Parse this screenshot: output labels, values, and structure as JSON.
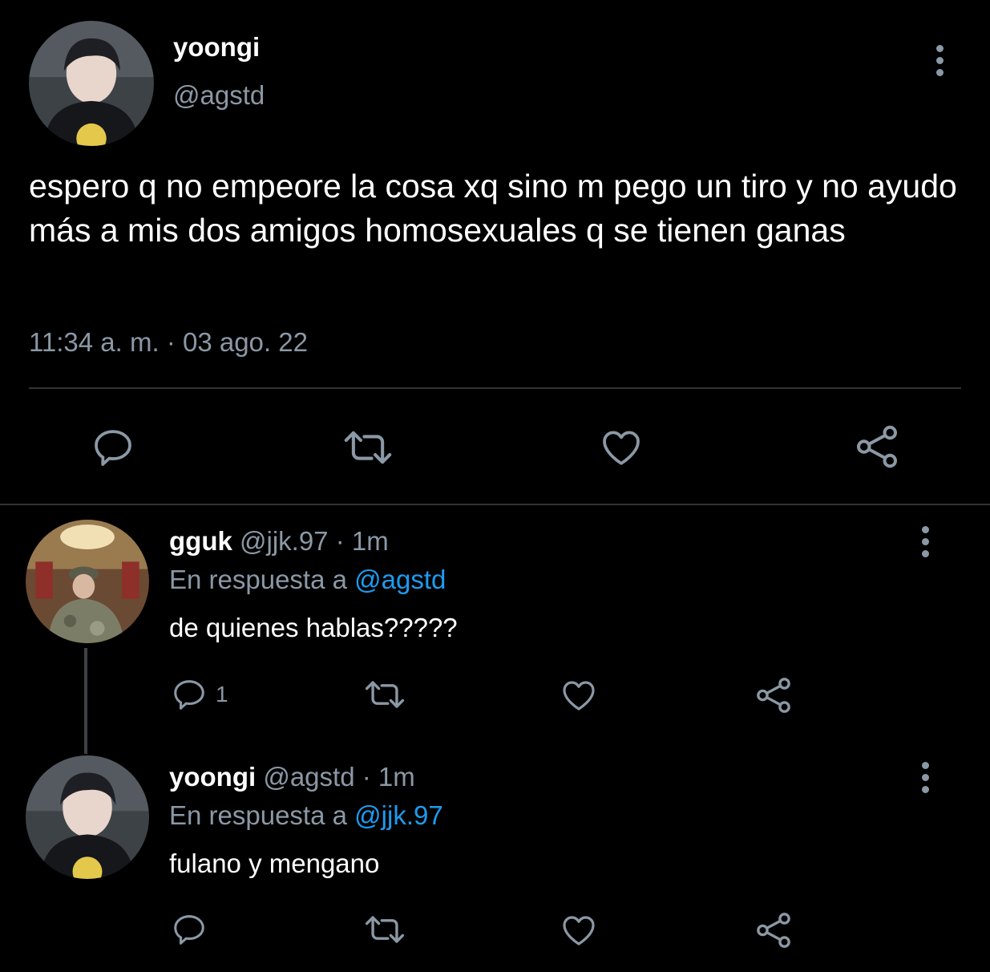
{
  "main_tweet": {
    "name": "yoongi",
    "handle": "@agstd",
    "text": "espero q no empeore la cosa xq sino m pego un tiro y no ayudo más a mis dos amigos homosexuales q se tienen ganas",
    "timestamp": "11:34 a. m. · 03 ago. 22",
    "actions": [
      "reply-icon",
      "retweet-icon",
      "like-icon",
      "share-icon"
    ]
  },
  "replies": [
    {
      "name": "gguk",
      "handle": "@jjk.97",
      "time": "· 1m",
      "reply_prefix": "En respuesta a",
      "reply_to": "@agstd",
      "text": "de quienes hablas?????",
      "reply_count": "1"
    },
    {
      "name": "yoongi",
      "handle": "@agstd",
      "time": "· 1m",
      "reply_prefix": "En respuesta a",
      "reply_to": "@jjk.97",
      "text": "fulano y mengano",
      "reply_count": ""
    }
  ],
  "colors": {
    "background": "#000000",
    "text": "#ffffff",
    "muted": "#8b98a5",
    "link": "#1d9bf0",
    "divider": "#2f3336"
  }
}
